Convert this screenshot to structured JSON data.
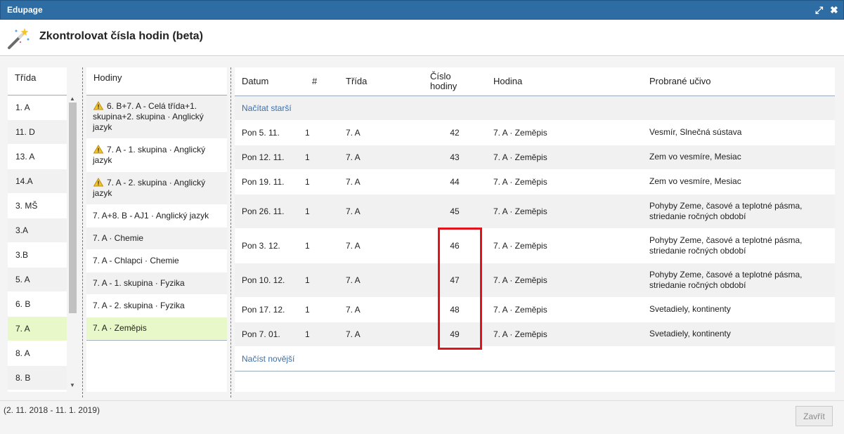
{
  "window": {
    "title": "Edupage"
  },
  "dialog": {
    "title": "Zkontrolovat čísla hodin (beta)"
  },
  "classes": {
    "header": "Třída",
    "items": [
      {
        "label": "1. A",
        "state": ""
      },
      {
        "label": "11. D",
        "state": "alt"
      },
      {
        "label": "13. A",
        "state": ""
      },
      {
        "label": "14.A",
        "state": "alt"
      },
      {
        "label": "3. MŠ",
        "state": ""
      },
      {
        "label": "3.A",
        "state": "alt"
      },
      {
        "label": "3.B",
        "state": ""
      },
      {
        "label": "5. A",
        "state": "alt"
      },
      {
        "label": "6. B",
        "state": ""
      },
      {
        "label": "7. A",
        "state": "sel"
      },
      {
        "label": "8. A",
        "state": ""
      },
      {
        "label": "8. B",
        "state": "alt"
      }
    ]
  },
  "lessons": {
    "header": "Hodiny",
    "items": [
      {
        "label": "6. B+7. A - Celá třída+1. skupina+2. skupina · Anglický jazyk",
        "warning": true,
        "state": "alt"
      },
      {
        "label": "7. A - 1. skupina · Anglický jazyk",
        "warning": true,
        "state": ""
      },
      {
        "label": "7. A - 2. skupina · Anglický jazyk",
        "warning": true,
        "state": "alt"
      },
      {
        "label": "7. A+8. B - AJ1 · Anglický jazyk",
        "warning": false,
        "state": ""
      },
      {
        "label": "7. A · Chemie",
        "warning": false,
        "state": "alt"
      },
      {
        "label": "7. A - Chlapci · Chemie",
        "warning": false,
        "state": ""
      },
      {
        "label": "7. A - 1. skupina · Fyzika",
        "warning": false,
        "state": "alt"
      },
      {
        "label": "7. A - 2. skupina · Fyzika",
        "warning": false,
        "state": ""
      },
      {
        "label": "7. A · Zeměpis",
        "warning": false,
        "state": "sel"
      }
    ]
  },
  "table": {
    "headers": {
      "date": "Datum",
      "hash": "#",
      "class": "Třída",
      "lesson_no": "Číslo hodiny",
      "lesson": "Hodina",
      "topic": "Probrané učivo"
    },
    "load_older": "Načítat starší",
    "load_newer": "Načíst novější",
    "rows": [
      {
        "date": "Pon 5. 11.",
        "hash": "1",
        "class": "7. A",
        "number": "42",
        "lesson": "7. A · Zeměpis",
        "topic": "Vesmír, Slnečná sústava",
        "tall": false
      },
      {
        "date": "Pon 12. 11.",
        "hash": "1",
        "class": "7. A",
        "number": "43",
        "lesson": "7. A · Zeměpis",
        "topic": "Zem vo vesmíre, Mesiac",
        "tall": false
      },
      {
        "date": "Pon 19. 11.",
        "hash": "1",
        "class": "7. A",
        "number": "44",
        "lesson": "7. A · Zeměpis",
        "topic": "Zem vo vesmíre, Mesiac",
        "tall": false
      },
      {
        "date": "Pon 26. 11.",
        "hash": "1",
        "class": "7. A",
        "number": "45",
        "lesson": "7. A · Zeměpis",
        "topic": "Pohyby Zeme, časové a teplotné pásma, striedanie ročných období",
        "tall": true
      },
      {
        "date": "Pon 3. 12.",
        "hash": "1",
        "class": "7. A",
        "number": "46",
        "lesson": "7. A · Zeměpis",
        "topic": "Pohyby Zeme, časové a teplotné pásma, striedanie ročných období",
        "tall": true
      },
      {
        "date": "Pon 10. 12.",
        "hash": "1",
        "class": "7. A",
        "number": "47",
        "lesson": "7. A · Zeměpis",
        "topic": "Pohyby Zeme, časové a teplotné pásma, striedanie ročných období",
        "tall": true
      },
      {
        "date": "Pon 17. 12.",
        "hash": "1",
        "class": "7. A",
        "number": "48",
        "lesson": "7. A · Zeměpis",
        "topic": "Svetadiely, kontinenty",
        "tall": false
      },
      {
        "date": "Pon 7. 01.",
        "hash": "1",
        "class": "7. A",
        "number": "49",
        "lesson": "7. A · Zeměpis",
        "topic": "Svetadiely, kontinenty",
        "tall": false
      }
    ]
  },
  "footer": {
    "range": "(2. 11. 2018 - 11. 1. 2019)",
    "close_label": "Zavřít"
  }
}
